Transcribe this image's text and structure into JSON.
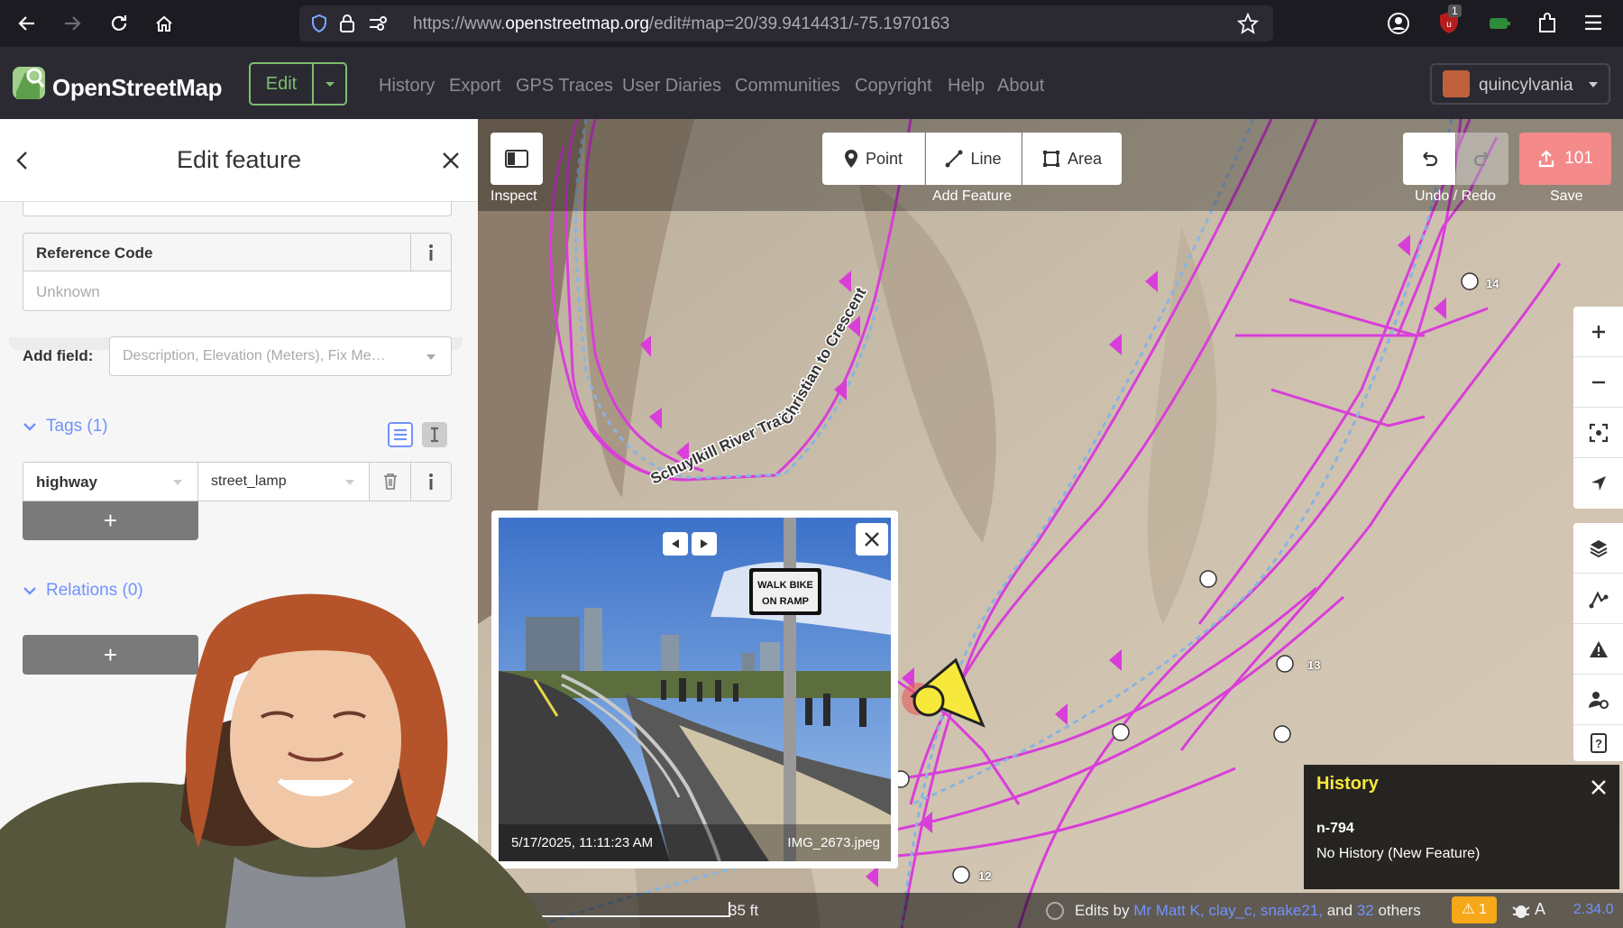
{
  "browser": {
    "url_prefix": "https://www.",
    "url_domain": "openstreetmap.org",
    "url_path": "/edit#map=20/39.9414431/-75.1970163",
    "extension_badge": "1"
  },
  "osm": {
    "brand": "OpenStreetMap",
    "edit_label": "Edit",
    "nav": [
      "History",
      "Export",
      "GPS Traces",
      "User Diaries",
      "Communities",
      "Copyright",
      "Help",
      "About"
    ],
    "username": "quincylvania"
  },
  "sidebar": {
    "title": "Edit feature",
    "reference_code_label": "Reference Code",
    "reference_code_placeholder": "Unknown",
    "add_field_label": "Add field:",
    "add_field_placeholder": "Description, Elevation (Meters), Fix Me…",
    "tags_heading": "Tags (1)",
    "tag_key": "highway",
    "tag_value": "street_lamp",
    "relations_heading": "Relations (0)",
    "add_symbol": "+"
  },
  "map": {
    "inspect_label": "Inspect",
    "point_label": "Point",
    "line_label": "Line",
    "area_label": "Area",
    "add_feature_label": "Add Feature",
    "undo_redo_label": "Undo / Redo",
    "save_count": "101",
    "save_label": "Save",
    "trail_label": "Schuylkill River Trail – Christian to Crescent",
    "node_labels": [
      "14",
      "13",
      "12"
    ],
    "photo": {
      "date": "5/17/2025, 11:11:23 AM",
      "filename": "IMG_2673.jpeg",
      "sign_line1": "WALK BIKE",
      "sign_line2": "ON RAMP"
    },
    "history": {
      "title": "History",
      "id": "n-794",
      "status": "No History (New Feature)"
    },
    "footer": {
      "scale": "35 ft",
      "edits_prefix": "Edits by",
      "editors": "Mr Matt K, clay_c, snake21,",
      "and": "and",
      "others_count": "32",
      "others": "others",
      "issues": "1",
      "version": "2.34.0"
    }
  },
  "colors": {
    "osm_green": "#7ebc6f",
    "idblue": "#7092ff",
    "save": "#f58a8a",
    "trail_magenta": "#d93ed9",
    "selected_yellow": "#f7e83c"
  }
}
